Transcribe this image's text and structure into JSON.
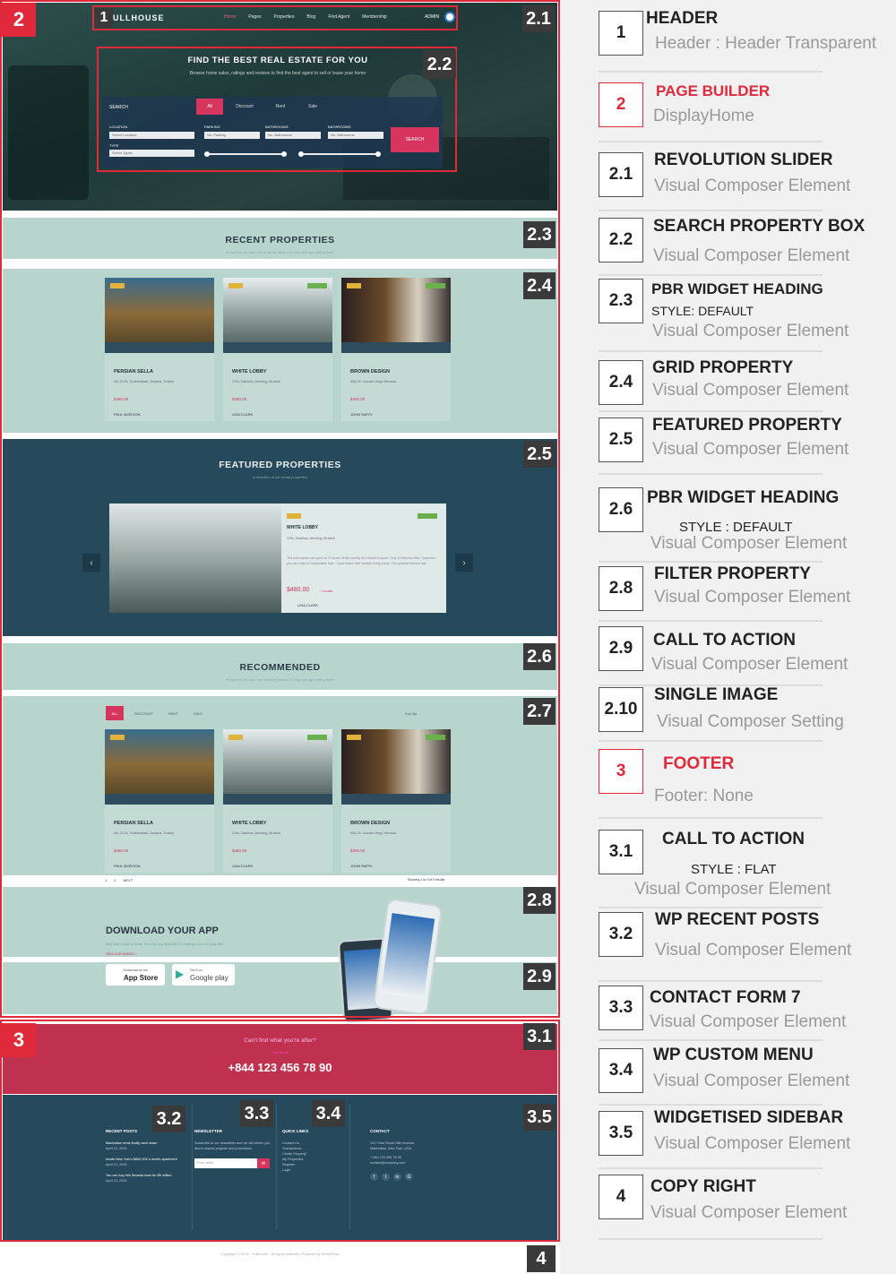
{
  "screenshot": {
    "labels": {
      "l1": "1",
      "l2": "2",
      "l21": "2.1",
      "l22": "2.2",
      "l23": "2.3",
      "l24": "2.4",
      "l25": "2.5",
      "l26": "2.6",
      "l27": "2.7",
      "l28": "2.8",
      "l29": "2.9",
      "l3": "3",
      "l31": "3.1",
      "l32": "3.2",
      "l33": "3.3",
      "l34": "3.4",
      "l35": "3.5",
      "l4": "4"
    },
    "header": {
      "logo": "ULLHOUSE",
      "nav": [
        "Home",
        "Pages",
        "Properties",
        "Blog",
        "Find Agent",
        "Membership"
      ],
      "admin": "ADMIN"
    },
    "hero": {
      "title": "FIND THE BEST REAL ESTATE FOR YOU",
      "subtitle": "Browse home sales, ratings and reviews to find the best agent to sell or lease your home",
      "search_label": "SEARCH",
      "tabs": [
        "All",
        "Discount",
        "Rent",
        "Sale"
      ],
      "fields": [
        "LOCATION",
        "PARKING",
        "BATHROOMS",
        "BATHROOMS"
      ],
      "selects": [
        "Select Location",
        "No. Parking",
        "No. Bathrooms",
        "No. Bathrooms"
      ],
      "type_label": "TYPE",
      "type_select": "Select Types",
      "search_button": "SEARCH"
    },
    "recent": {
      "title": "RECENT PROPERTIES",
      "subtitle": "Properties for sale, we currently have a 21 day average selling time!"
    },
    "cards": [
      {
        "title": "PERSIAN SELLA",
        "address": "No 23 St, Sofemabari, Ankara, Turkey",
        "price": "$480.00",
        "agent": "PAUL MORGON"
      },
      {
        "title": "WHITE LOBBY",
        "address": "17th, Dachau, binning, Munich",
        "price": "$480.00",
        "agent": "LINA CLARK"
      },
      {
        "title": "BROWN DESIGN",
        "address": "456 St, Lincoln Hwy, Nevada",
        "price": "$200.00",
        "agent": "JOHN SMITH"
      }
    ],
    "featured": {
      "title": "FEATURED PROPERTIES",
      "subtitle": "A selection of our rental properties",
      "card_title": "WHITE LOBBY",
      "card_address": "17th, Dachau, binning, Munich",
      "card_text": "The best starter set upon on 31 acres of flat country the choice is yours. Only 10 Minutes from Towcester you can enjoy a comfortable barn - local charm with multiple living areas. The quietest kitchen has",
      "price": "$480.00",
      "price_unit": "/ month",
      "agent": "LINA CLARK"
    },
    "recommended": {
      "title": "RECOMMENDED",
      "subtitle": "Properties for sale, we currently have a 21 day average selling time!",
      "filters": [
        "ALL",
        "DISCOUNT",
        "RENT",
        "SALE"
      ],
      "sort": "Sort By",
      "pagination": [
        "1",
        "2",
        "NEXT"
      ],
      "results": "Showing 1 to 3 of 5 results"
    },
    "app": {
      "title": "DOWNLOAD YOUR APP",
      "subtitle": "Best sale property rental, the only app dedicated to making your everyday life!",
      "link": "VIEW OUR MOBILE >",
      "store1": "App Store",
      "store1_small": "Download on the",
      "store2": "Google play",
      "store2_small": "Get it on"
    },
    "cta": {
      "question": "Can't find what you're after?",
      "call": "Call us on",
      "phone": "+844 123 456 78 90"
    },
    "footer": {
      "recent_posts_title": "RECENT POSTS",
      "recent_posts": [
        {
          "title": "Manhattan rents finally went down",
          "date": "April 13, 2016"
        },
        {
          "title": "Inside New York's $800,000 a month apartment",
          "date": "April 13, 2016"
        },
        {
          "title": "You can buy this Nevada town for $8 million",
          "date": "April 13, 2016"
        }
      ],
      "newsletter_title": "NEWSLETTER",
      "newsletter_text": "Subscribe to our newsletter and we will inform you about newest projects and promotions",
      "newsletter_placeholder": "Enter email",
      "quick_links_title": "QUICK LINKS",
      "quick_links": [
        "Contact Us",
        "Transactions",
        "Create Property",
        "My Properties",
        "Register",
        "Login"
      ],
      "contact_title": "CONTACT",
      "contact": [
        "123 Third Street 25th Avenue,",
        "Manhattan, New York, USA",
        "+ 844 123 456 78 90",
        "contact@company.com"
      ]
    },
    "copyright": "Copyright © 2016 - FullHouse - All rights reserved. Powered by WordPress"
  },
  "legend": [
    {
      "num": "1",
      "title": "HEADER",
      "sub": "Header : Header Transparent",
      "red": false
    },
    {
      "num": "2",
      "title": "PAGE BUILDER",
      "sub": "DisplayHome",
      "red": true
    },
    {
      "num": "2.1",
      "title": "REVOLUTION SLIDER",
      "sub": "Visual Composer Element",
      "red": false
    },
    {
      "num": "2.2",
      "title": "SEARCH PROPERTY BOX",
      "sub": "Visual Composer Element",
      "red": false
    },
    {
      "num": "2.3",
      "title": "PBR WIDGET HEADING",
      "style": "STYLE: DEFAULT",
      "sub": "Visual Composer Element",
      "red": false
    },
    {
      "num": "2.4",
      "title": "GRID PROPERTY",
      "sub": "Visual Composer Element",
      "red": false
    },
    {
      "num": "2.5",
      "title": "FEATURED PROPERTY",
      "sub": "Visual Composer Element",
      "red": false
    },
    {
      "num": "2.6",
      "title": "PBR WIDGET HEADING",
      "style": "STYLE : DEFAULT",
      "sub": "Visual Composer Element",
      "red": false
    },
    {
      "num": "2.8",
      "title": "FILTER PROPERTY",
      "sub": "Visual Composer Element",
      "red": false
    },
    {
      "num": "2.9",
      "title": "CALL TO ACTION",
      "sub": "Visual Composer Element",
      "red": false
    },
    {
      "num": "2.10",
      "title": "SINGLE IMAGE",
      "sub": "Visual Composer Setting",
      "red": false
    },
    {
      "num": "3",
      "title": "FOOTER",
      "sub": "Footer: None",
      "red": true
    },
    {
      "num": "3.1",
      "title": "CALL TO ACTION",
      "style": "STYLE : FLAT",
      "sub": "Visual Composer Element",
      "red": false
    },
    {
      "num": "3.2",
      "title": "WP RECENT POSTS",
      "sub": "Visual Composer Element",
      "red": false
    },
    {
      "num": "3.3",
      "title": "CONTACT FORM 7",
      "sub": "Visual Composer Element",
      "red": false
    },
    {
      "num": "3.4",
      "title": "WP CUSTOM MENU",
      "sub": "Visual Composer Element",
      "red": false
    },
    {
      "num": "3.5",
      "title": "WIDGETISED SIDEBAR",
      "sub": "Visual Composer Element",
      "red": false
    },
    {
      "num": "4",
      "title": "COPY RIGHT",
      "sub": "Visual Composer Element",
      "red": false
    }
  ],
  "colors": {
    "accent_red": "#e0293a",
    "brand_pink": "#d7345e",
    "teal_band": "#b7d4cd",
    "navy": "#27495c"
  }
}
